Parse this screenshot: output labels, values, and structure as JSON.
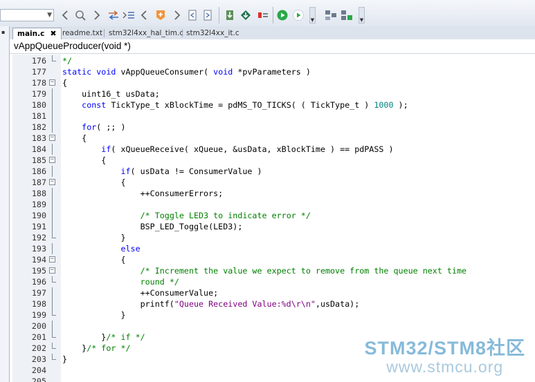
{
  "toolbar": {
    "combo_value": "",
    "buttons": [
      "nav-back",
      "search",
      "nav-forward",
      "find-ref",
      "outline",
      "prev",
      "bookmark",
      "next",
      "doc-prev",
      "doc-next",
      "download",
      "flash",
      "debug-config",
      "run",
      "run-step",
      "layout",
      "layout-add"
    ]
  },
  "tabs": [
    {
      "label": "main.c",
      "active": true,
      "close": "✖"
    },
    {
      "label": "readme.txt",
      "active": false
    },
    {
      "label": "stm32l4xx_hal_tim.c",
      "active": false
    },
    {
      "label": "stm32l4xx_it.c",
      "active": false
    }
  ],
  "function_bar": "vAppQueueProducer(void *)",
  "lines": [
    {
      "num": "176",
      "fold": "end",
      "parts": [
        {
          "t": "*/",
          "c": "cm"
        }
      ]
    },
    {
      "num": "177",
      "fold": "",
      "parts": [
        {
          "t": "static void ",
          "c": "kw"
        },
        {
          "t": "vAppQueueConsumer( ",
          "c": ""
        },
        {
          "t": "void",
          "c": "kw"
        },
        {
          "t": " *pvParameters )",
          "c": ""
        }
      ]
    },
    {
      "num": "178",
      "fold": "open",
      "parts": [
        {
          "t": "{",
          "c": ""
        }
      ]
    },
    {
      "num": "179",
      "fold": "line",
      "parts": [
        {
          "t": "    uint16_t usData;",
          "c": ""
        }
      ]
    },
    {
      "num": "180",
      "fold": "line",
      "parts": [
        {
          "t": "    ",
          "c": ""
        },
        {
          "t": "const",
          "c": "kw"
        },
        {
          "t": " TickType_t xBlockTime = pdMS_TO_TICKS( ( TickType_t ) ",
          "c": ""
        },
        {
          "t": "1000",
          "c": "num"
        },
        {
          "t": " );",
          "c": ""
        }
      ]
    },
    {
      "num": "181",
      "fold": "line",
      "parts": [
        {
          "t": "",
          "c": ""
        }
      ]
    },
    {
      "num": "182",
      "fold": "line",
      "parts": [
        {
          "t": "    ",
          "c": ""
        },
        {
          "t": "for",
          "c": "kw"
        },
        {
          "t": "( ;; )",
          "c": ""
        }
      ]
    },
    {
      "num": "183",
      "fold": "open",
      "parts": [
        {
          "t": "    {",
          "c": ""
        }
      ]
    },
    {
      "num": "184",
      "fold": "line",
      "parts": [
        {
          "t": "        ",
          "c": ""
        },
        {
          "t": "if",
          "c": "kw"
        },
        {
          "t": "( xQueueReceive( xQueue, &usData, xBlockTime ) == pdPASS )",
          "c": ""
        }
      ]
    },
    {
      "num": "185",
      "fold": "open",
      "parts": [
        {
          "t": "        {",
          "c": ""
        }
      ]
    },
    {
      "num": "186",
      "fold": "line",
      "parts": [
        {
          "t": "            ",
          "c": ""
        },
        {
          "t": "if",
          "c": "kw"
        },
        {
          "t": "( usData != ConsumerValue )",
          "c": ""
        }
      ]
    },
    {
      "num": "187",
      "fold": "open",
      "parts": [
        {
          "t": "            {",
          "c": ""
        }
      ]
    },
    {
      "num": "188",
      "fold": "line",
      "parts": [
        {
          "t": "                ++ConsumerErrors;",
          "c": ""
        }
      ]
    },
    {
      "num": "189",
      "fold": "line",
      "parts": [
        {
          "t": "",
          "c": ""
        }
      ]
    },
    {
      "num": "190",
      "fold": "line",
      "parts": [
        {
          "t": "                ",
          "c": ""
        },
        {
          "t": "/* Toggle LED3 to indicate error */",
          "c": "cm"
        }
      ]
    },
    {
      "num": "191",
      "fold": "line",
      "parts": [
        {
          "t": "                BSP_LED_Toggle(LED3);",
          "c": ""
        }
      ]
    },
    {
      "num": "192",
      "fold": "end",
      "parts": [
        {
          "t": "            }",
          "c": ""
        }
      ]
    },
    {
      "num": "193",
      "fold": "line",
      "parts": [
        {
          "t": "            ",
          "c": ""
        },
        {
          "t": "else",
          "c": "kw"
        }
      ]
    },
    {
      "num": "194",
      "fold": "open",
      "parts": [
        {
          "t": "            {",
          "c": ""
        }
      ]
    },
    {
      "num": "195",
      "fold": "open",
      "parts": [
        {
          "t": "                ",
          "c": ""
        },
        {
          "t": "/* Increment the value we expect to remove from the queue next time",
          "c": "cm"
        }
      ]
    },
    {
      "num": "196",
      "fold": "end",
      "parts": [
        {
          "t": "                ",
          "c": ""
        },
        {
          "t": "round */",
          "c": "cm"
        }
      ]
    },
    {
      "num": "197",
      "fold": "line",
      "parts": [
        {
          "t": "                ++ConsumerValue;",
          "c": ""
        }
      ]
    },
    {
      "num": "198",
      "fold": "line",
      "parts": [
        {
          "t": "                printf(",
          "c": ""
        },
        {
          "t": "\"Queue Received Value:%d\\r\\n\"",
          "c": "str"
        },
        {
          "t": ",usData);",
          "c": ""
        }
      ]
    },
    {
      "num": "199",
      "fold": "end",
      "parts": [
        {
          "t": "            }",
          "c": ""
        }
      ]
    },
    {
      "num": "200",
      "fold": "line",
      "parts": [
        {
          "t": "",
          "c": ""
        }
      ]
    },
    {
      "num": "201",
      "fold": "end",
      "parts": [
        {
          "t": "        }",
          "c": ""
        },
        {
          "t": "/* if */",
          "c": "cm"
        }
      ]
    },
    {
      "num": "202",
      "fold": "end",
      "parts": [
        {
          "t": "    }",
          "c": ""
        },
        {
          "t": "/* for */",
          "c": "cm"
        }
      ]
    },
    {
      "num": "203",
      "fold": "end",
      "parts": [
        {
          "t": "}",
          "c": ""
        }
      ]
    },
    {
      "num": "204",
      "fold": "",
      "parts": [
        {
          "t": "",
          "c": ""
        }
      ]
    },
    {
      "num": "205",
      "fold": "",
      "parts": [
        {
          "t": "",
          "c": ""
        }
      ]
    }
  ],
  "watermark": {
    "title": "STM32/STM8社区",
    "url": "www.stmcu.org"
  },
  "colors": {
    "keyword": "#0000ff",
    "comment": "#008000",
    "string": "#800080",
    "number": "#008080"
  }
}
